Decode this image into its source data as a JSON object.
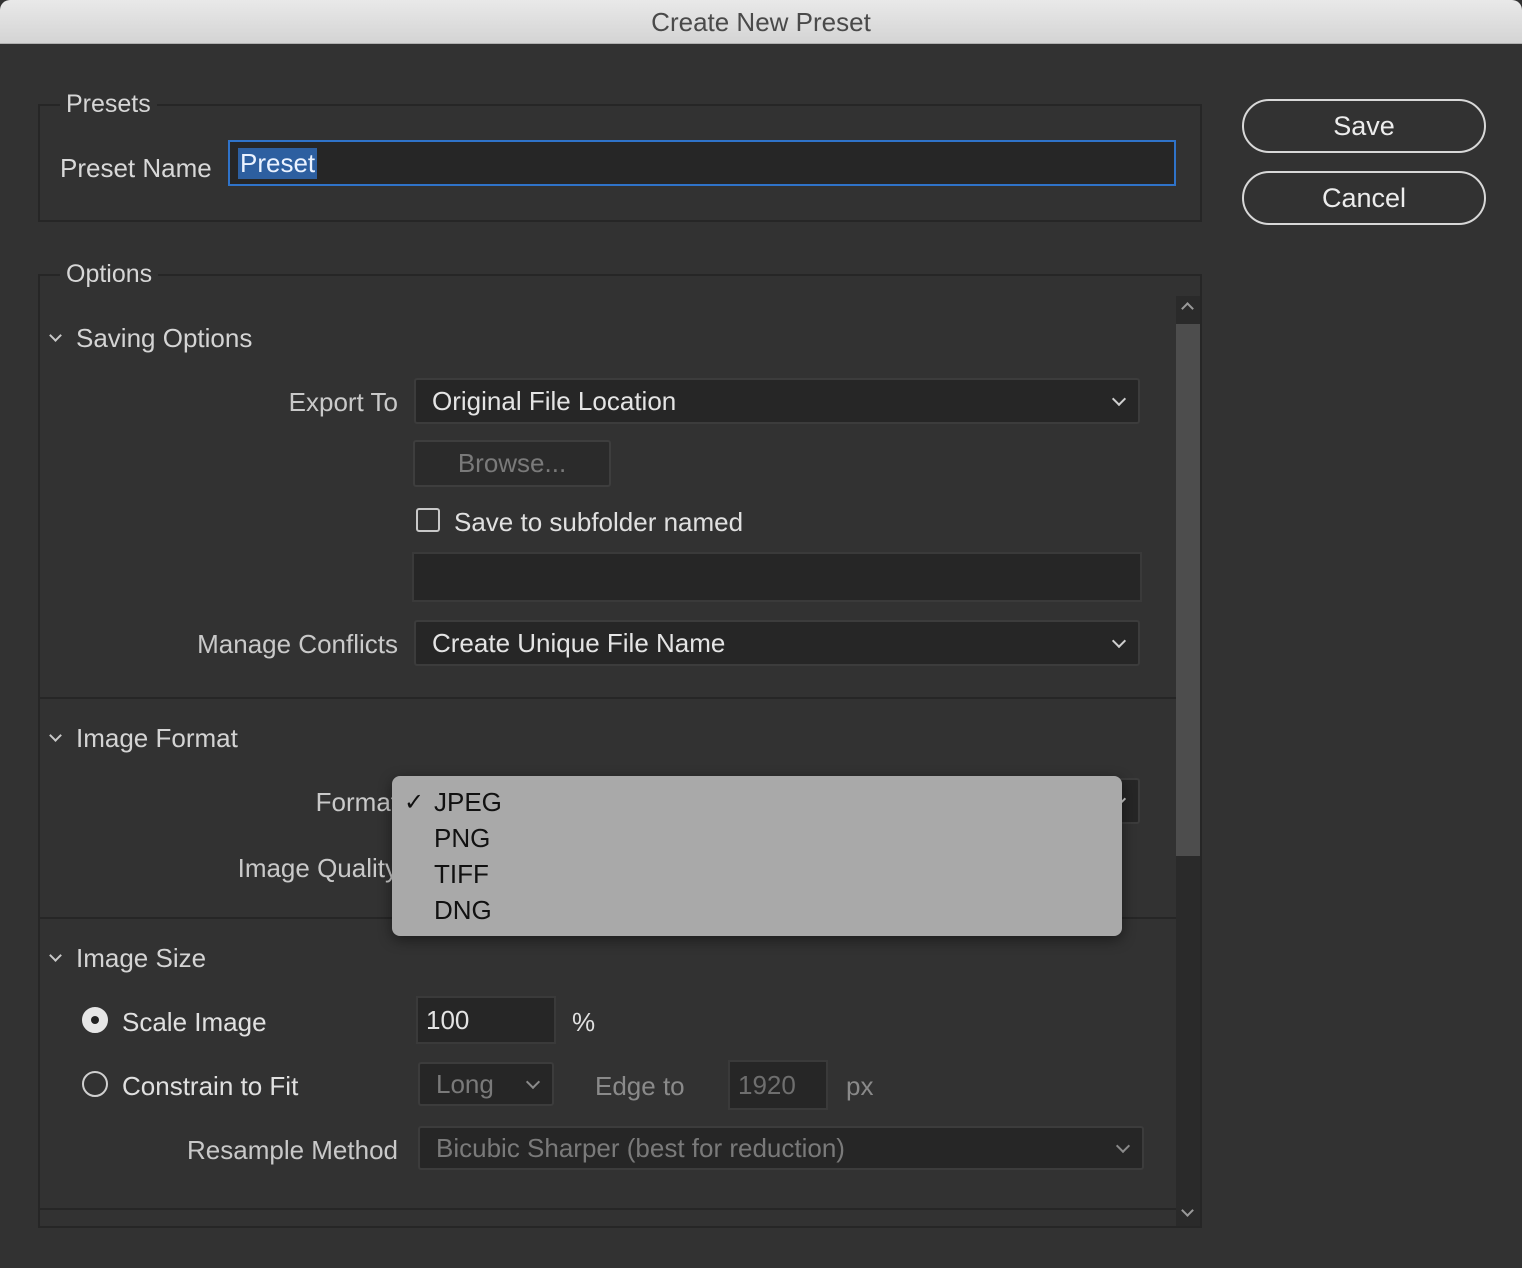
{
  "window": {
    "title": "Create New Preset"
  },
  "presets": {
    "group_title": "Presets",
    "name_label": "Preset Name",
    "name_value": "Preset"
  },
  "actions": {
    "save_label": "Save",
    "cancel_label": "Cancel"
  },
  "options": {
    "group_title": "Options",
    "saving_options": {
      "title": "Saving Options",
      "export_to_label": "Export To",
      "export_to_value": "Original File Location",
      "browse_label": "Browse...",
      "subfolder_label": "Save to subfolder named",
      "subfolder_checked": false,
      "subfolder_value": "",
      "manage_conflicts_label": "Manage Conflicts",
      "manage_conflicts_value": "Create Unique File Name"
    },
    "image_format": {
      "title": "Image Format",
      "format_label": "Format",
      "image_quality_label": "Image Quality",
      "format_menu": {
        "check_glyph": "✓",
        "items": [
          "JPEG",
          "PNG",
          "TIFF",
          "DNG"
        ],
        "selected": "JPEG"
      }
    },
    "image_size": {
      "title": "Image Size",
      "scale_image_label": "Scale Image",
      "scale_image_selected": true,
      "scale_value": "100",
      "scale_unit": "%",
      "constrain_label": "Constrain to Fit",
      "constrain_selected": false,
      "edge_select_value": "Long",
      "edge_to_label": "Edge to",
      "edge_value": "1920",
      "edge_unit": "px",
      "resample_label": "Resample Method",
      "resample_value": "Bicubic Sharper (best for reduction)"
    }
  }
}
